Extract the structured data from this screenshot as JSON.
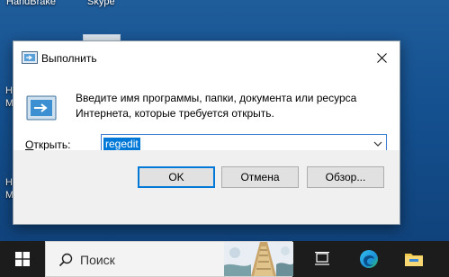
{
  "desktop": {
    "labels": [
      "HandBrake",
      "Skype"
    ]
  },
  "dialog": {
    "title": "Выполнить",
    "description": "Введите имя программы, папки, документа или ресурса Интернета, которые требуется открыть.",
    "open_label_prefix": "О",
    "open_label_rest": "ткрыть:",
    "input_value": "regedit",
    "buttons": {
      "ok": "OK",
      "cancel": "Отмена",
      "browse": "Обзор..."
    }
  },
  "taskbar": {
    "search_placeholder": "Поиск",
    "icons": [
      "windows-start-icon",
      "search-icon",
      "task-view-icon",
      "edge-icon",
      "file-explorer-icon"
    ]
  },
  "colors": {
    "accent": "#0078d7",
    "taskbar": "#1c1c1c",
    "dialog_footer": "#f0f0f0"
  }
}
